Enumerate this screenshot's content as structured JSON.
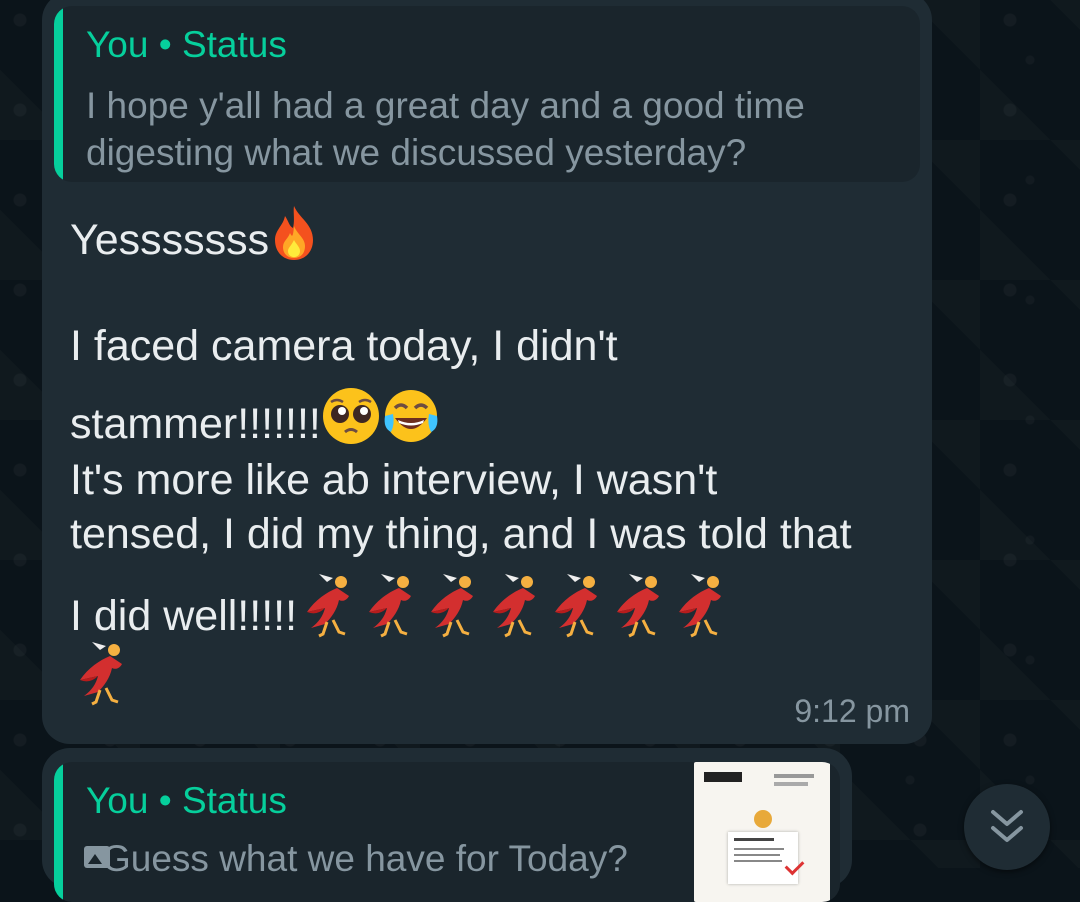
{
  "colors": {
    "bubble": "#1f2c34",
    "quote_bg": "#1a252c",
    "accent": "#06cf9c",
    "primary_text": "#e9edef",
    "secondary_text": "#8696a0",
    "background": "#0b141a"
  },
  "message": {
    "quote": {
      "sender": "You • Status",
      "text": "I hope y'all had a great day and a good time digesting what we discussed yesterday?"
    },
    "lines": [
      "Yesssssss",
      "I faced camera today, I didn't",
      "stammer!!!!!!!",
      "It's more like ab interview, I wasn't",
      "tensed, I did my thing, and I was told that",
      "I did well!!!!!"
    ],
    "emojis": {
      "line1": "fire-emoji",
      "line3": [
        "pleading-face-emoji",
        "tears-of-joy-emoji"
      ],
      "line6": "woman-dancing-emoji",
      "line6_count": 7,
      "line7_count": 1
    },
    "time": "9:12 pm"
  },
  "next_message": {
    "quote": {
      "sender": "You • Status",
      "text": "Guess what we have for Today?",
      "icon": "image-icon"
    },
    "thumbnail_icon": "flyer-thumbnail"
  },
  "scroll_button": {
    "icon": "double-chevron-down-icon"
  }
}
